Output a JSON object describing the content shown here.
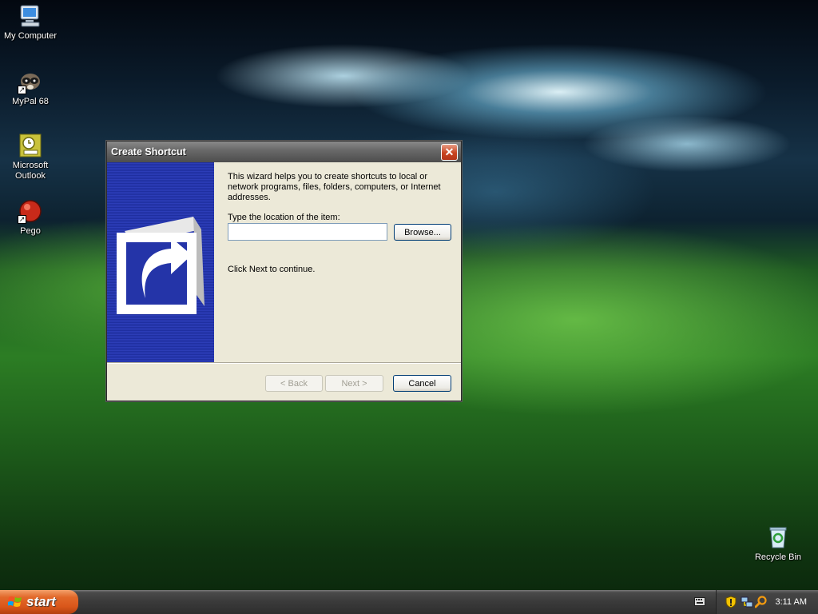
{
  "desktop": {
    "icons": [
      {
        "label": "My Computer",
        "icon": "my-computer-icon"
      },
      {
        "label": "MyPal 68",
        "icon": "mypal-browser-icon"
      },
      {
        "label": "Microsoft Outlook",
        "icon": "outlook-icon"
      },
      {
        "label": "Pego",
        "icon": "pego-icon"
      },
      {
        "label": "Recycle Bin",
        "icon": "recycle-bin-icon"
      }
    ]
  },
  "dialog": {
    "title": "Create Shortcut",
    "close_label": "✕",
    "description": "This wizard helps you to create shortcuts to local or network programs, files, folders, computers, or Internet addresses.",
    "location_label": "Type the location of the item:",
    "location_value": "",
    "browse_label": "Browse...",
    "next_hint": "Click Next to continue.",
    "back_label": "< Back",
    "next_label": "Next >",
    "cancel_label": "Cancel"
  },
  "taskbar": {
    "start_label": "start",
    "clock": "3:11 AM",
    "tray_icons": [
      "security-shield-icon",
      "network-icon",
      "search-icon"
    ]
  }
}
